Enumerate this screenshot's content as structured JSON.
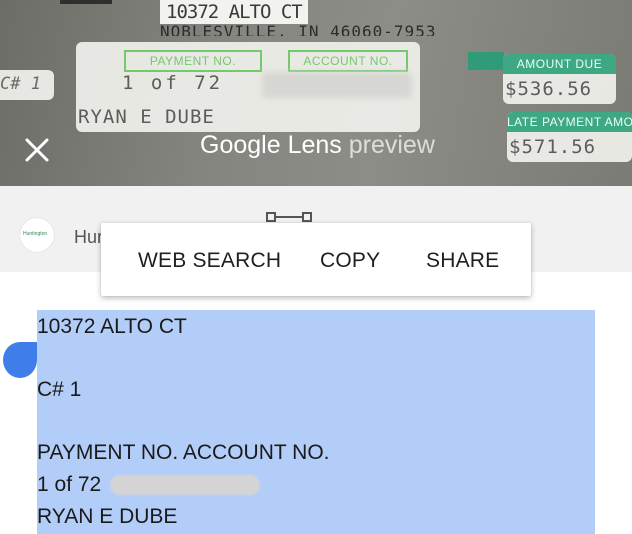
{
  "preview": {
    "address_line": "10372 ALTO CT",
    "city_line": "NOBLESVILLE, IN 46060-7953",
    "customer_id": "C# 1",
    "payment_no_label": "PAYMENT NO.",
    "account_no_label": "ACCOUNT NO.",
    "payment_value": "1 of 72",
    "customer_name": "RYAN E DUBE",
    "amount_due_label": "AMOUNT DUE",
    "amount_due_value": "$536.56",
    "late_payment_label": "LATE PAYMENT AMOUNT",
    "late_payment_value": "$571.56",
    "lens_google": "Google",
    "lens_word": "Lens",
    "lens_preview": "preview"
  },
  "result": {
    "site_logo": "Huntington",
    "site_name": "Hur"
  },
  "menu": {
    "web_search": "WEB SEARCH",
    "copy": "COPY",
    "share": "SHARE"
  },
  "selection": {
    "line1": "10372 ALTO CT",
    "line2": "C# 1",
    "line3": "PAYMENT NO. ACCOUNT NO.",
    "line4": "1 of 72",
    "line5": "RYAN E DUBE"
  },
  "colors": {
    "selection_bg": "#b3cdf9",
    "handle": "#3f7ee8",
    "green_label": "#73c96c",
    "green_tab": "#3ea784"
  },
  "icons": [
    "close-icon",
    "drag-handle-icon",
    "selection-handle"
  ]
}
